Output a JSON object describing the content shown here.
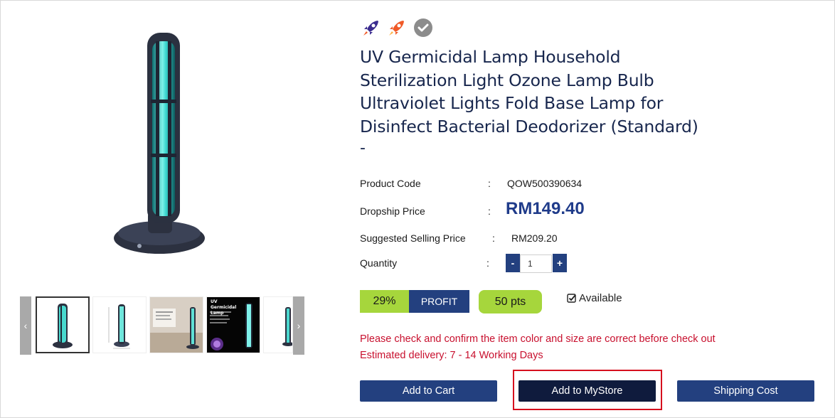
{
  "badges": [
    {
      "icon": "rocket-purple-icon",
      "color": "#3b2c8f"
    },
    {
      "icon": "rocket-orange-icon",
      "color": "#f05a28"
    },
    {
      "icon": "check-circle-icon",
      "color": "#8c8c8c"
    }
  ],
  "product": {
    "title_lines": [
      "UV Germicidal Lamp Household",
      "Sterilization Light Ozone Lamp Bulb",
      "Ultraviolet Lights Fold Base Lamp for",
      "Disinfect Bacterial Deodorizer (Standard)"
    ],
    "title_suffix": "-",
    "code_label": "Product Code",
    "code": "QOW500390634",
    "dropship_label": "Dropship Price",
    "dropship_price": "RM149.40",
    "suggested_label": "Suggested Selling Price",
    "suggested_price": "RM209.20",
    "colon": ":"
  },
  "quantity": {
    "label": "Quantity",
    "minus": "-",
    "plus": "+",
    "value": "1"
  },
  "profit": {
    "percent": "29%",
    "label": "PROFIT",
    "points": "50 pts"
  },
  "availability": {
    "icon": "checkbox-checked-icon",
    "label": "Available"
  },
  "notices": {
    "check": "Please check and confirm the item color and size are correct before check out",
    "delivery": "Estimated delivery: 7 - 14 Working Days"
  },
  "buttons": {
    "add_to_cart": "Add to Cart",
    "add_to_mystore": "Add to MyStore",
    "shipping_cost": "Shipping Cost"
  },
  "carousel": {
    "prev_icon": "chevron-left-icon",
    "next_icon": "chevron-right-icon",
    "thumb_text": "UV Germicidal Lamp"
  },
  "colors": {
    "navy": "#17264d",
    "brand_blue": "#23407f",
    "dark_button": "#0f1b3d",
    "green": "#a6d63c",
    "alert_red": "#c8102e",
    "highlight": "#d6101e"
  }
}
